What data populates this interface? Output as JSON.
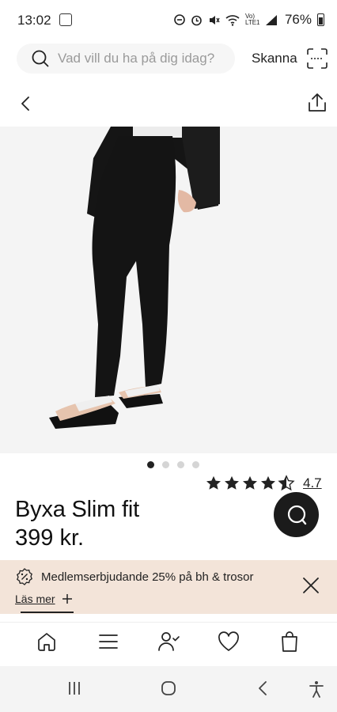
{
  "status_bar": {
    "time": "13:02",
    "battery_percent": "76%",
    "network_label": "Vo) LTE1"
  },
  "search": {
    "placeholder": "Vad vill du ha på dig idag?",
    "scan_label": "Skanna"
  },
  "product": {
    "title": "Byxa Slim fit",
    "price": "399 kr.",
    "rating_value": "4.7",
    "rating_stars": 4.5,
    "image_count": 4,
    "active_image_index": 0
  },
  "promo": {
    "text": "Medlemserbjudande 25% på bh & trosor",
    "read_more": "Läs mer",
    "background_color": "#f3e4d9"
  },
  "bottom_nav": {
    "items": [
      "home-icon",
      "menu-icon",
      "account-icon",
      "heart-icon",
      "bag-icon"
    ]
  },
  "colors": {
    "text": "#111111",
    "chat_button": "#1b1b1b"
  }
}
